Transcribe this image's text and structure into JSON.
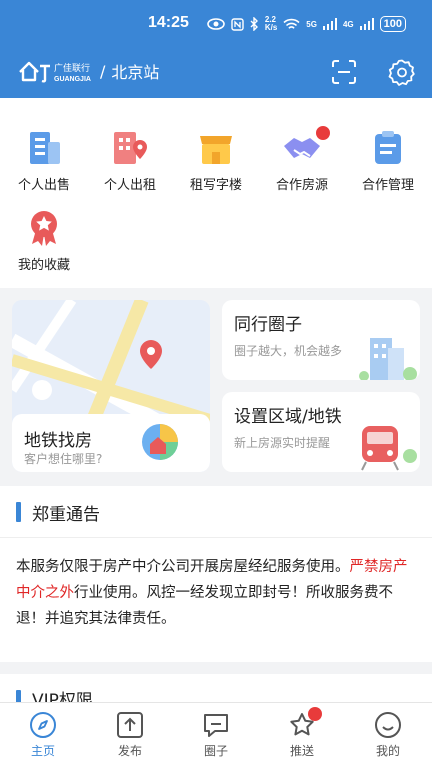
{
  "status": {
    "time": "14:25",
    "net_speed_top": "2.2",
    "net_speed_bottom": "K/s",
    "network": "5G",
    "signal": "4G",
    "battery": "100"
  },
  "header": {
    "brand_cn": "广佳联行",
    "brand_en": "GUANGJIA",
    "separator": "/",
    "station": "北京站"
  },
  "quick": [
    {
      "label": "个人出售",
      "icon": "building-icon"
    },
    {
      "label": "个人出租",
      "icon": "building-pin-icon"
    },
    {
      "label": "租写字楼",
      "icon": "shop-icon"
    },
    {
      "label": "合作房源",
      "icon": "handshake-icon",
      "badge": true
    },
    {
      "label": "合作管理",
      "icon": "clipboard-icon"
    },
    {
      "label": "我的收藏",
      "icon": "ribbon-star-icon"
    }
  ],
  "cards": {
    "metro": {
      "title": "地铁找房",
      "sub": "客户想住哪里?"
    },
    "circle": {
      "title": "同行圈子",
      "sub": "圈子越大，机会越多"
    },
    "area": {
      "title": "设置区域/地铁",
      "sub": "新上房源实时提醒"
    }
  },
  "notice": {
    "title": "郑重通告",
    "text_before": "本服务仅限于房产中介公司开展房屋经纪服务使用。",
    "text_red": "严禁房产中介之外",
    "text_after": "行业使用。风控一经发现立即封号！所收服务费不退！并追究其法律责任。"
  },
  "vip": {
    "title": "VIP权限"
  },
  "nav": [
    {
      "label": "主页",
      "icon": "compass-icon",
      "active": true
    },
    {
      "label": "发布",
      "icon": "upload-icon"
    },
    {
      "label": "圈子",
      "icon": "chat-icon"
    },
    {
      "label": "推送",
      "icon": "star-icon",
      "badge": true
    },
    {
      "label": "我的",
      "icon": "smile-icon"
    }
  ],
  "colors": {
    "primary": "#3a86d6",
    "warning": "#e02727"
  }
}
